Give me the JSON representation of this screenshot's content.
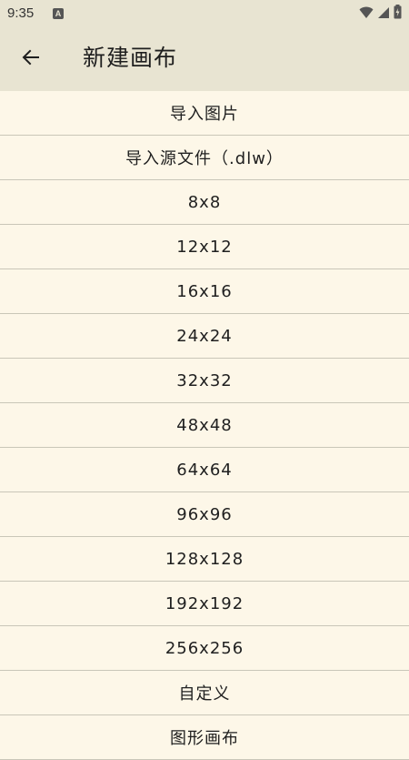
{
  "status": {
    "time": "9:35",
    "notification_badge": "A"
  },
  "appbar": {
    "title": "新建画布",
    "back_icon": "arrow-left-icon"
  },
  "options": [
    "导入图片",
    "导入源文件（.dlw）",
    "8x8",
    "12x12",
    "16x16",
    "24x24",
    "32x32",
    "48x48",
    "64x64",
    "96x96",
    "128x128",
    "192x192",
    "256x256",
    "自定义",
    "图形画布"
  ],
  "colors": {
    "background": "#fdf7e8",
    "appbar": "#e8e4d2",
    "divider": "#c9c6b8"
  }
}
